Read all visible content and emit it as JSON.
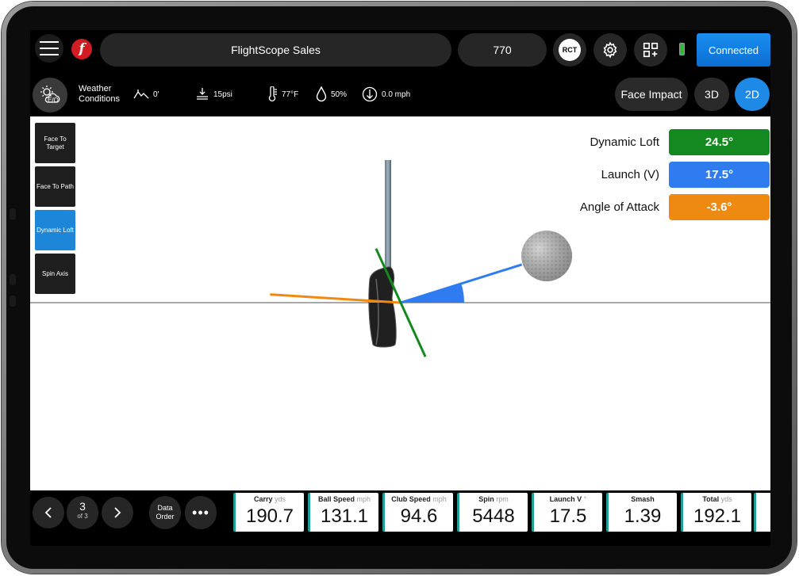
{
  "header": {
    "title": "FlightScope Sales",
    "device_number": "770",
    "rct_label": "RCT",
    "connection_status": "Connected"
  },
  "weather": {
    "icon_label": "E/O",
    "label": "Weather Conditions",
    "altitude": "0'",
    "pressure": "15psi",
    "temperature": "77°F",
    "humidity": "50%",
    "wind": "0.0 mph"
  },
  "view_buttons": {
    "face_impact": "Face Impact",
    "three_d": "3D",
    "two_d": "2D"
  },
  "side_tabs": [
    {
      "label": "Face To Target",
      "active": false
    },
    {
      "label": "Face To Path",
      "active": false
    },
    {
      "label": "Dynamic Loft",
      "active": true
    },
    {
      "label": "Spin Axis",
      "active": false
    }
  ],
  "metrics": [
    {
      "label": "Dynamic Loft",
      "value": "24.5°",
      "color": "#14891f"
    },
    {
      "label": "Launch (V)",
      "value": "17.5°",
      "color": "#2e7cf0"
    },
    {
      "label": "Angle of Attack",
      "value": "-3.6°",
      "color": "#ee8a12"
    }
  ],
  "angles": {
    "dynamic_loft_deg": 24.5,
    "launch_v_deg": 17.5,
    "angle_of_attack_deg": -3.6
  },
  "pagination": {
    "current": "3",
    "of": "of 3"
  },
  "data_order_label": "Data Order",
  "more_label": "•••",
  "tiles": [
    {
      "label": "Carry",
      "unit": "yds",
      "value": "190.7"
    },
    {
      "label": "Ball Speed",
      "unit": "mph",
      "value": "131.1"
    },
    {
      "label": "Club Speed",
      "unit": "mph",
      "value": "94.6"
    },
    {
      "label": "Spin",
      "unit": "rpm",
      "value": "5448"
    },
    {
      "label": "Launch V",
      "unit": "°",
      "value": "17.5"
    },
    {
      "label": "Smash",
      "unit": "",
      "value": "1.39"
    },
    {
      "label": "Total",
      "unit": "yds",
      "value": "192.1"
    }
  ],
  "colors": {
    "accent_blue": "#1e8ae5",
    "tile_border": "#1f9e98",
    "logo_red": "#d11c24"
  }
}
